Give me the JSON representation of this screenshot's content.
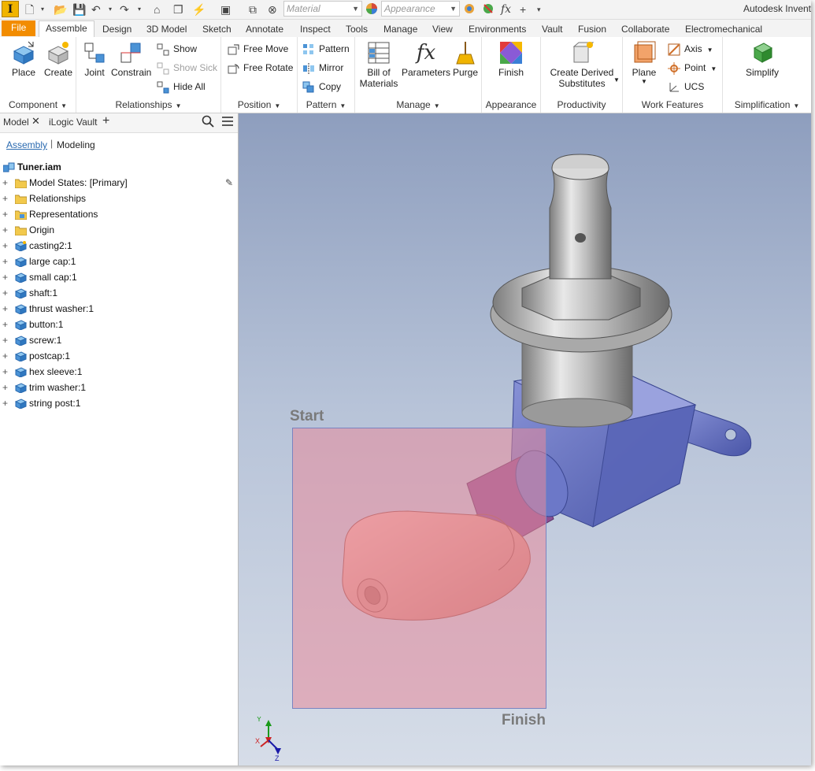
{
  "app": {
    "logo_letter": "I",
    "title": "Autodesk Invent",
    "material_placeholder": "Material",
    "appearance_placeholder": "Appearance",
    "fx_label": "fx"
  },
  "tabs": [
    "File",
    "Assemble",
    "Design",
    "3D Model",
    "Sketch",
    "Annotate",
    "Inspect",
    "Tools",
    "Manage",
    "View",
    "Environments",
    "Vault",
    "Fusion",
    "Collaborate",
    "Electromechanical"
  ],
  "active_tab": "Assemble",
  "ribbon": {
    "component": {
      "label": "Component",
      "place": "Place",
      "create": "Create"
    },
    "relationships": {
      "label": "Relationships",
      "joint": "Joint",
      "constrain": "Constrain",
      "show": "Show",
      "show_sick": "Show Sick",
      "hide_all": "Hide All"
    },
    "position": {
      "label": "Position",
      "free_move": "Free Move",
      "free_rotate": "Free Rotate"
    },
    "pattern": {
      "label": "Pattern",
      "pattern": "Pattern",
      "mirror": "Mirror",
      "copy": "Copy"
    },
    "manage": {
      "label": "Manage",
      "bom_line1": "Bill of",
      "bom_line2": "Materials",
      "parameters": "Parameters",
      "purge": "Purge"
    },
    "appearance": {
      "label": "Appearance",
      "finish": "Finish"
    },
    "productivity": {
      "label": "Productivity",
      "derived_line1": "Create Derived",
      "derived_line2": "Substitutes"
    },
    "work_features": {
      "label": "Work Features",
      "plane": "Plane",
      "axis": "Axis",
      "point": "Point",
      "ucs": "UCS"
    },
    "simplification": {
      "label": "Simplification",
      "simplify": "Simplify"
    }
  },
  "browser": {
    "tabs": {
      "model": "Model",
      "ilogic": "iLogic",
      "vault": "Vault"
    },
    "subtabs": {
      "assembly": "Assembly",
      "modeling": "Modeling"
    },
    "root": "Tuner.iam",
    "items": [
      {
        "label": "Model States: [Primary]",
        "icon": "folder"
      },
      {
        "label": "Relationships",
        "icon": "folder"
      },
      {
        "label": "Representations",
        "icon": "folder-rep"
      },
      {
        "label": "Origin",
        "icon": "folder"
      },
      {
        "label": "casting2:1",
        "icon": "part-derived"
      },
      {
        "label": "large cap:1",
        "icon": "part"
      },
      {
        "label": "small cap:1",
        "icon": "part"
      },
      {
        "label": "shaft:1",
        "icon": "part"
      },
      {
        "label": "thrust washer:1",
        "icon": "part"
      },
      {
        "label": "button:1",
        "icon": "part"
      },
      {
        "label": "screw:1",
        "icon": "part"
      },
      {
        "label": "postcap:1",
        "icon": "part"
      },
      {
        "label": "hex sleeve:1",
        "icon": "part"
      },
      {
        "label": "trim washer:1",
        "icon": "part"
      },
      {
        "label": "string post:1",
        "icon": "part"
      }
    ]
  },
  "viewport": {
    "start_label": "Start",
    "finish_label": "Finish",
    "triad": {
      "x": "X",
      "y": "Y",
      "z": "Z"
    }
  },
  "colors": {
    "file_tab": "#f28c00",
    "selection_box": "#e88a9a",
    "casting": "#6c78c8",
    "button": "#d9928a"
  }
}
